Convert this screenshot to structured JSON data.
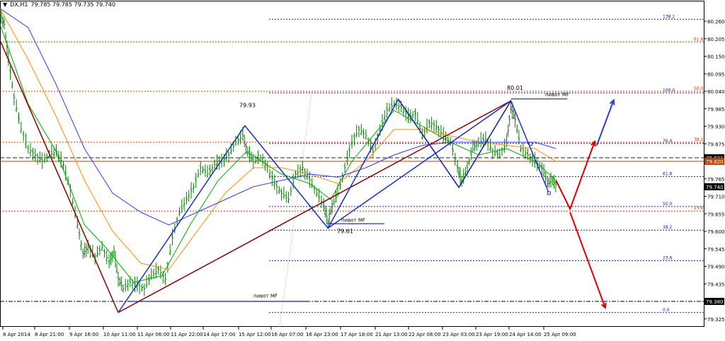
{
  "header": {
    "symbol": "DX,H1",
    "ohlc": "79.785 79.785 79.735 79.740"
  },
  "colors": {
    "price_bars": "#008000",
    "ma_fast": "#00aa00",
    "ma_mid": "#ff8c00",
    "ma_slow": "#3a3af0",
    "pattern_blue": "#1a2ec8",
    "trend_dark": "#8b0000",
    "trend_navy": "#1a1a9a",
    "fib_orange": "#c04000",
    "fib_navy": "#1a1a8a",
    "forecast_red": "#e00000",
    "forecast_blue": "#2a40d0"
  },
  "chart_data": {
    "type": "line",
    "title": "",
    "ylim": [
      79.3,
      80.3
    ],
    "yticks": [
      "80.260",
      "80.205",
      "80.150",
      "80.095",
      "80.040",
      "79.985",
      "79.930",
      "79.875",
      "79.820",
      "79.765",
      "79.710",
      "79.655",
      "79.600",
      "79.545",
      "79.490",
      "79.435",
      "79.380",
      "79.325"
    ],
    "xticks": [
      "8 Apr 2014",
      "8 Apr 21:00",
      "9 Apr 16:00",
      "10 Apr 11:00",
      "11 Apr 06:00",
      "11 Apr 22:00",
      "14 Apr 17:00",
      "15 Apr 12:00",
      "16 Apr 07:00",
      "16 Apr 23:00",
      "17 Apr 18:00",
      "21 Apr 13:00",
      "22 Apr 08:00",
      "23 Apr 03:00",
      "23 Apr 19:00",
      "24 Apr 14:00",
      "25 Apr 09:00"
    ],
    "price_path": [
      [
        0,
        80.28
      ],
      [
        6,
        80.25
      ],
      [
        12,
        80.14
      ],
      [
        20,
        80.02
      ],
      [
        30,
        79.92
      ],
      [
        40,
        79.86
      ],
      [
        50,
        79.84
      ],
      [
        60,
        79.82
      ],
      [
        70,
        79.84
      ],
      [
        80,
        79.85
      ],
      [
        90,
        79.81
      ],
      [
        100,
        79.73
      ],
      [
        110,
        79.62
      ],
      [
        118,
        79.53
      ],
      [
        125,
        79.55
      ],
      [
        135,
        79.52
      ],
      [
        145,
        79.55
      ],
      [
        155,
        79.5
      ],
      [
        162,
        79.54
      ],
      [
        168,
        79.45
      ],
      [
        175,
        79.42
      ],
      [
        185,
        79.44
      ],
      [
        195,
        79.43
      ],
      [
        205,
        79.42
      ],
      [
        215,
        79.46
      ],
      [
        225,
        79.48
      ],
      [
        235,
        79.45
      ],
      [
        245,
        79.58
      ],
      [
        255,
        79.66
      ],
      [
        265,
        79.7
      ],
      [
        275,
        79.74
      ],
      [
        285,
        79.8
      ],
      [
        295,
        79.78
      ],
      [
        305,
        79.81
      ],
      [
        315,
        79.82
      ],
      [
        325,
        79.84
      ],
      [
        335,
        79.88
      ],
      [
        345,
        79.9
      ],
      [
        352,
        79.85
      ],
      [
        360,
        79.82
      ],
      [
        370,
        79.83
      ],
      [
        380,
        79.8
      ],
      [
        390,
        79.75
      ],
      [
        400,
        79.72
      ],
      [
        410,
        79.7
      ],
      [
        420,
        79.78
      ],
      [
        430,
        79.8
      ],
      [
        440,
        79.76
      ],
      [
        450,
        79.72
      ],
      [
        460,
        79.68
      ],
      [
        466,
        79.63
      ],
      [
        472,
        79.68
      ],
      [
        480,
        79.72
      ],
      [
        490,
        79.8
      ],
      [
        500,
        79.88
      ],
      [
        510,
        79.92
      ],
      [
        520,
        79.9
      ],
      [
        530,
        79.85
      ],
      [
        540,
        79.92
      ],
      [
        550,
        79.98
      ],
      [
        560,
        80.0
      ],
      [
        570,
        79.99
      ],
      [
        580,
        79.96
      ],
      [
        590,
        79.97
      ],
      [
        600,
        79.9
      ],
      [
        610,
        79.94
      ],
      [
        620,
        79.93
      ],
      [
        630,
        79.9
      ],
      [
        640,
        79.88
      ],
      [
        650,
        79.8
      ],
      [
        656,
        79.76
      ],
      [
        664,
        79.8
      ],
      [
        672,
        79.86
      ],
      [
        680,
        79.88
      ],
      [
        690,
        79.89
      ],
      [
        700,
        79.85
      ],
      [
        710,
        79.84
      ],
      [
        720,
        79.88
      ],
      [
        726,
        79.99
      ],
      [
        732,
        79.95
      ],
      [
        740,
        79.86
      ],
      [
        750,
        79.84
      ],
      [
        760,
        79.82
      ],
      [
        770,
        79.8
      ],
      [
        778,
        79.75
      ],
      [
        785,
        79.76
      ],
      [
        792,
        79.74
      ]
    ],
    "series": [
      {
        "values": [
          [
            0,
            80.25
          ],
          [
            40,
            80.0
          ],
          [
            80,
            79.85
          ],
          [
            120,
            79.62
          ],
          [
            150,
            79.55
          ],
          [
            190,
            79.44
          ],
          [
            230,
            79.46
          ],
          [
            270,
            79.62
          ],
          [
            310,
            79.76
          ],
          [
            350,
            79.85
          ],
          [
            400,
            79.78
          ],
          [
            440,
            79.75
          ],
          [
            470,
            79.7
          ],
          [
            500,
            79.82
          ],
          [
            530,
            79.9
          ],
          [
            560,
            79.98
          ],
          [
            600,
            79.93
          ],
          [
            640,
            79.88
          ],
          [
            680,
            79.84
          ],
          [
            720,
            79.86
          ],
          [
            760,
            79.82
          ],
          [
            790,
            79.76
          ]
        ]
      },
      {
        "values": [
          [
            0,
            80.3
          ],
          [
            40,
            80.14
          ],
          [
            80,
            79.96
          ],
          [
            120,
            79.76
          ],
          [
            160,
            79.6
          ],
          [
            200,
            79.5
          ],
          [
            240,
            79.48
          ],
          [
            280,
            79.6
          ],
          [
            320,
            79.72
          ],
          [
            360,
            79.8
          ],
          [
            400,
            79.8
          ],
          [
            440,
            79.78
          ],
          [
            480,
            79.75
          ],
          [
            520,
            79.82
          ],
          [
            560,
            79.92
          ],
          [
            600,
            79.92
          ],
          [
            640,
            79.9
          ],
          [
            680,
            79.88
          ],
          [
            720,
            79.87
          ],
          [
            760,
            79.86
          ],
          [
            790,
            79.82
          ]
        ]
      },
      {
        "values": [
          [
            0,
            80.3
          ],
          [
            40,
            80.24
          ],
          [
            80,
            80.06
          ],
          [
            120,
            79.86
          ],
          [
            160,
            79.72
          ],
          [
            200,
            79.66
          ],
          [
            240,
            79.62
          ],
          [
            280,
            79.66
          ],
          [
            320,
            79.7
          ],
          [
            360,
            79.74
          ],
          [
            400,
            79.76
          ],
          [
            440,
            79.78
          ],
          [
            480,
            79.77
          ],
          [
            520,
            79.8
          ],
          [
            560,
            79.84
          ],
          [
            600,
            79.87
          ],
          [
            640,
            79.88
          ],
          [
            680,
            79.88
          ],
          [
            720,
            79.88
          ],
          [
            760,
            79.88
          ],
          [
            790,
            79.86
          ]
        ]
      }
    ],
    "hlevels": [
      {
        "value": 80.266,
        "label": "138.2",
        "style": "fib"
      },
      {
        "value": 80.195,
        "label": "61.8",
        "style": "fib_orange"
      },
      {
        "value": 80.035,
        "label": "100.0",
        "style": "fib"
      },
      {
        "value": 80.04,
        "label": "50.0",
        "style": "fib_orange"
      },
      {
        "value": 79.876,
        "label": "76.4",
        "style": "fib"
      },
      {
        "value": 79.88,
        "label": "38.2",
        "style": "fib_orange"
      },
      {
        "value": 79.831,
        "label": "79.831",
        "style": "solid_dark"
      },
      {
        "value": 79.82,
        "label": "79.820",
        "style": "solid_orange"
      },
      {
        "value": 79.772,
        "label": "61.8",
        "style": "fib"
      },
      {
        "value": 79.678,
        "label": "50.0",
        "style": "fib"
      },
      {
        "value": 79.664,
        "label": "23.6",
        "style": "fib_orange"
      },
      {
        "value": 79.604,
        "label": "38.2",
        "style": "fib"
      },
      {
        "value": 79.508,
        "label": "23.6",
        "style": "fib"
      },
      {
        "value": 79.38,
        "label": "79.380",
        "style": "dashdot"
      },
      {
        "value": 79.345,
        "label": "0.0",
        "style": "fib"
      }
    ],
    "price_label": "79.740",
    "annotations": [
      "79.93",
      "80.01",
      "79.61",
      "пивот MF",
      "пивот MF",
      "пивот MF"
    ],
    "pattern_points": [
      [
        168,
        79.345
      ],
      [
        348,
        79.932
      ],
      [
        466,
        79.61
      ],
      [
        566,
        80.015
      ],
      [
        652,
        79.738
      ],
      [
        726,
        80.01
      ],
      [
        780,
        79.72
      ]
    ],
    "trend_line": [
      [
        0,
        80.2
      ],
      [
        168,
        79.345
      ],
      [
        726,
        80.01
      ]
    ],
    "forecast_red": [
      [
        790,
        79.76
      ],
      [
        810,
        79.67
      ],
      [
        845,
        79.882
      ],
      [
        810,
        79.66
      ],
      [
        860,
        79.36
      ]
    ],
    "forecast_blue": [
      [
        848,
        79.87
      ],
      [
        872,
        80.012
      ]
    ]
  }
}
